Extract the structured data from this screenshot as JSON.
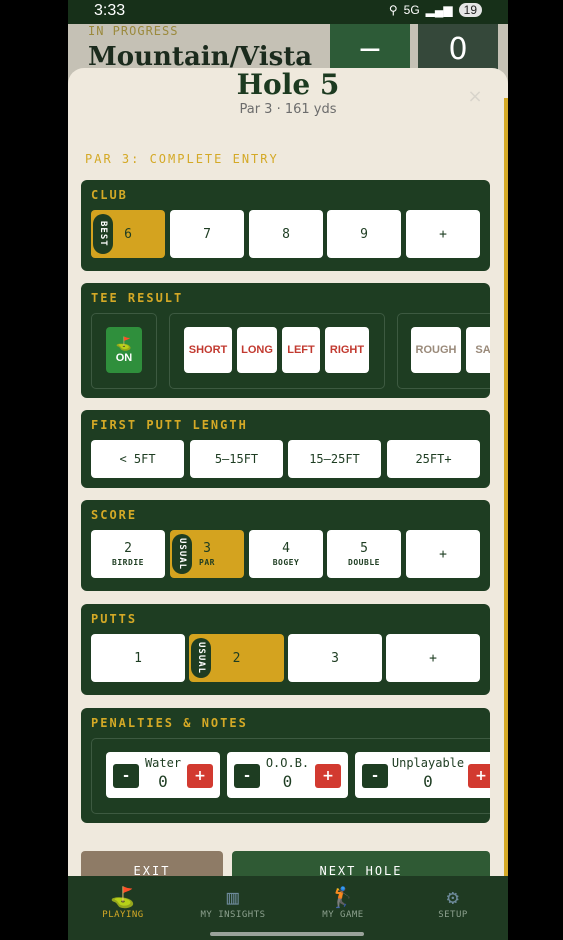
{
  "status_bar": {
    "time": "3:33",
    "signal": "5G",
    "battery": "19"
  },
  "background": {
    "status": "IN PROGRESS",
    "course": "Mountain/Vista",
    "minus": "−",
    "count": "0"
  },
  "hole": {
    "title": "Hole 5",
    "subtitle": "Par 3 · 161 yds",
    "close": "×"
  },
  "entry_label": "PAR 3: COMPLETE ENTRY",
  "club": {
    "label": "CLUB",
    "options": [
      {
        "value": "6",
        "tag": "BEST",
        "selected": true
      },
      {
        "value": "7"
      },
      {
        "value": "8"
      },
      {
        "value": "9"
      },
      {
        "value": "+"
      }
    ]
  },
  "tee_result": {
    "label": "TEE RESULT",
    "on": "ON",
    "misses": [
      "SHORT",
      "LONG",
      "LEFT",
      "RIGHT"
    ],
    "lies": [
      "ROUGH",
      "SAND"
    ]
  },
  "first_putt": {
    "label": "FIRST PUTT LENGTH",
    "options": [
      "< 5FT",
      "5–15FT",
      "15–25FT",
      "25FT+"
    ]
  },
  "score": {
    "label": "SCORE",
    "options": [
      {
        "value": "2",
        "sub": "BIRDIE"
      },
      {
        "value": "3",
        "sub": "PAR",
        "tag": "USUAL",
        "selected": true
      },
      {
        "value": "4",
        "sub": "BOGEY"
      },
      {
        "value": "5",
        "sub": "DOUBLE"
      },
      {
        "value": "+"
      }
    ]
  },
  "putts": {
    "label": "PUTTS",
    "options": [
      {
        "value": "1"
      },
      {
        "value": "2",
        "tag": "USUAL",
        "selected": true
      },
      {
        "value": "3"
      },
      {
        "value": "+"
      }
    ]
  },
  "penalties": {
    "label": "PENALTIES & NOTES",
    "items": [
      {
        "name": "Water",
        "value": "0"
      },
      {
        "name": "O.O.B.",
        "value": "0"
      },
      {
        "name": "Unplayable",
        "value": "0"
      }
    ],
    "dec": "-",
    "inc": "+"
  },
  "footer": {
    "exit": "EXIT",
    "next": "NEXT HOLE"
  },
  "nav": [
    {
      "label": "PLAYING",
      "icon": "flag-icon",
      "active": true
    },
    {
      "label": "MY INSIGHTS",
      "icon": "chart-icon"
    },
    {
      "label": "MY GAME",
      "icon": "golfer-icon"
    },
    {
      "label": "SETUP",
      "icon": "gear-icon"
    }
  ],
  "colors": {
    "primary": "#1e3d22",
    "accent": "#d4a926",
    "alert": "#d23a30",
    "sheet": "#efe9dd"
  }
}
